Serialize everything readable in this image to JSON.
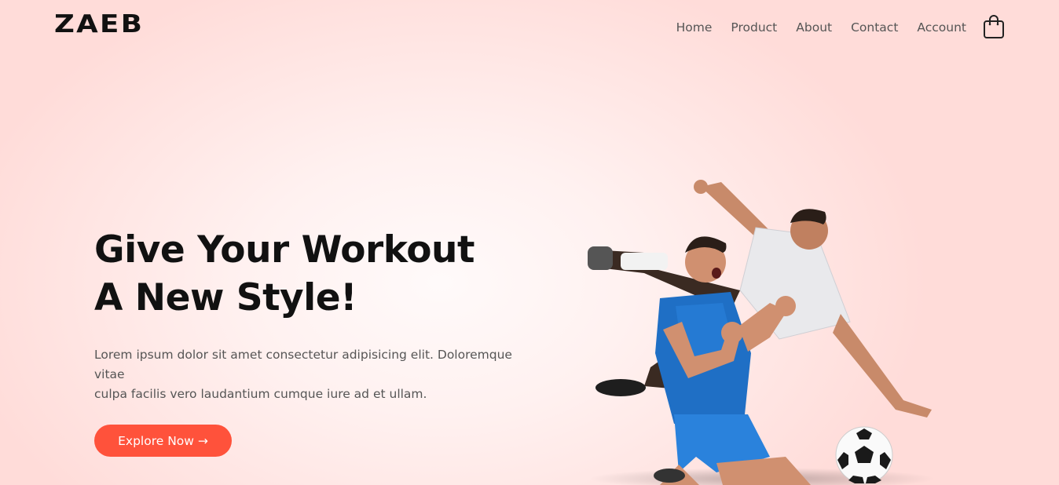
{
  "brand": {
    "logo_text": "ZAEB"
  },
  "nav": {
    "links": [
      {
        "label": "Home"
      },
      {
        "label": "Product"
      },
      {
        "label": "About"
      },
      {
        "label": "Contact"
      },
      {
        "label": "Account"
      }
    ],
    "cart_icon": "shopping-bag-icon"
  },
  "hero": {
    "title_line1": "Give Your Workout",
    "title_line2": "A New Style!",
    "desc_line1": "Lorem ipsum dolor sit amet consectetur adipisicing elit. Doloremque vitae",
    "desc_line2": "culpa facilis vero laudantium cumque iure ad et ullam.",
    "cta_label": "Explore Now →",
    "image_alt": "soccer-players-image"
  },
  "colors": {
    "accent": "#ff523b",
    "background": "#ffe4e1",
    "text": "#111111",
    "muted": "#555555"
  }
}
